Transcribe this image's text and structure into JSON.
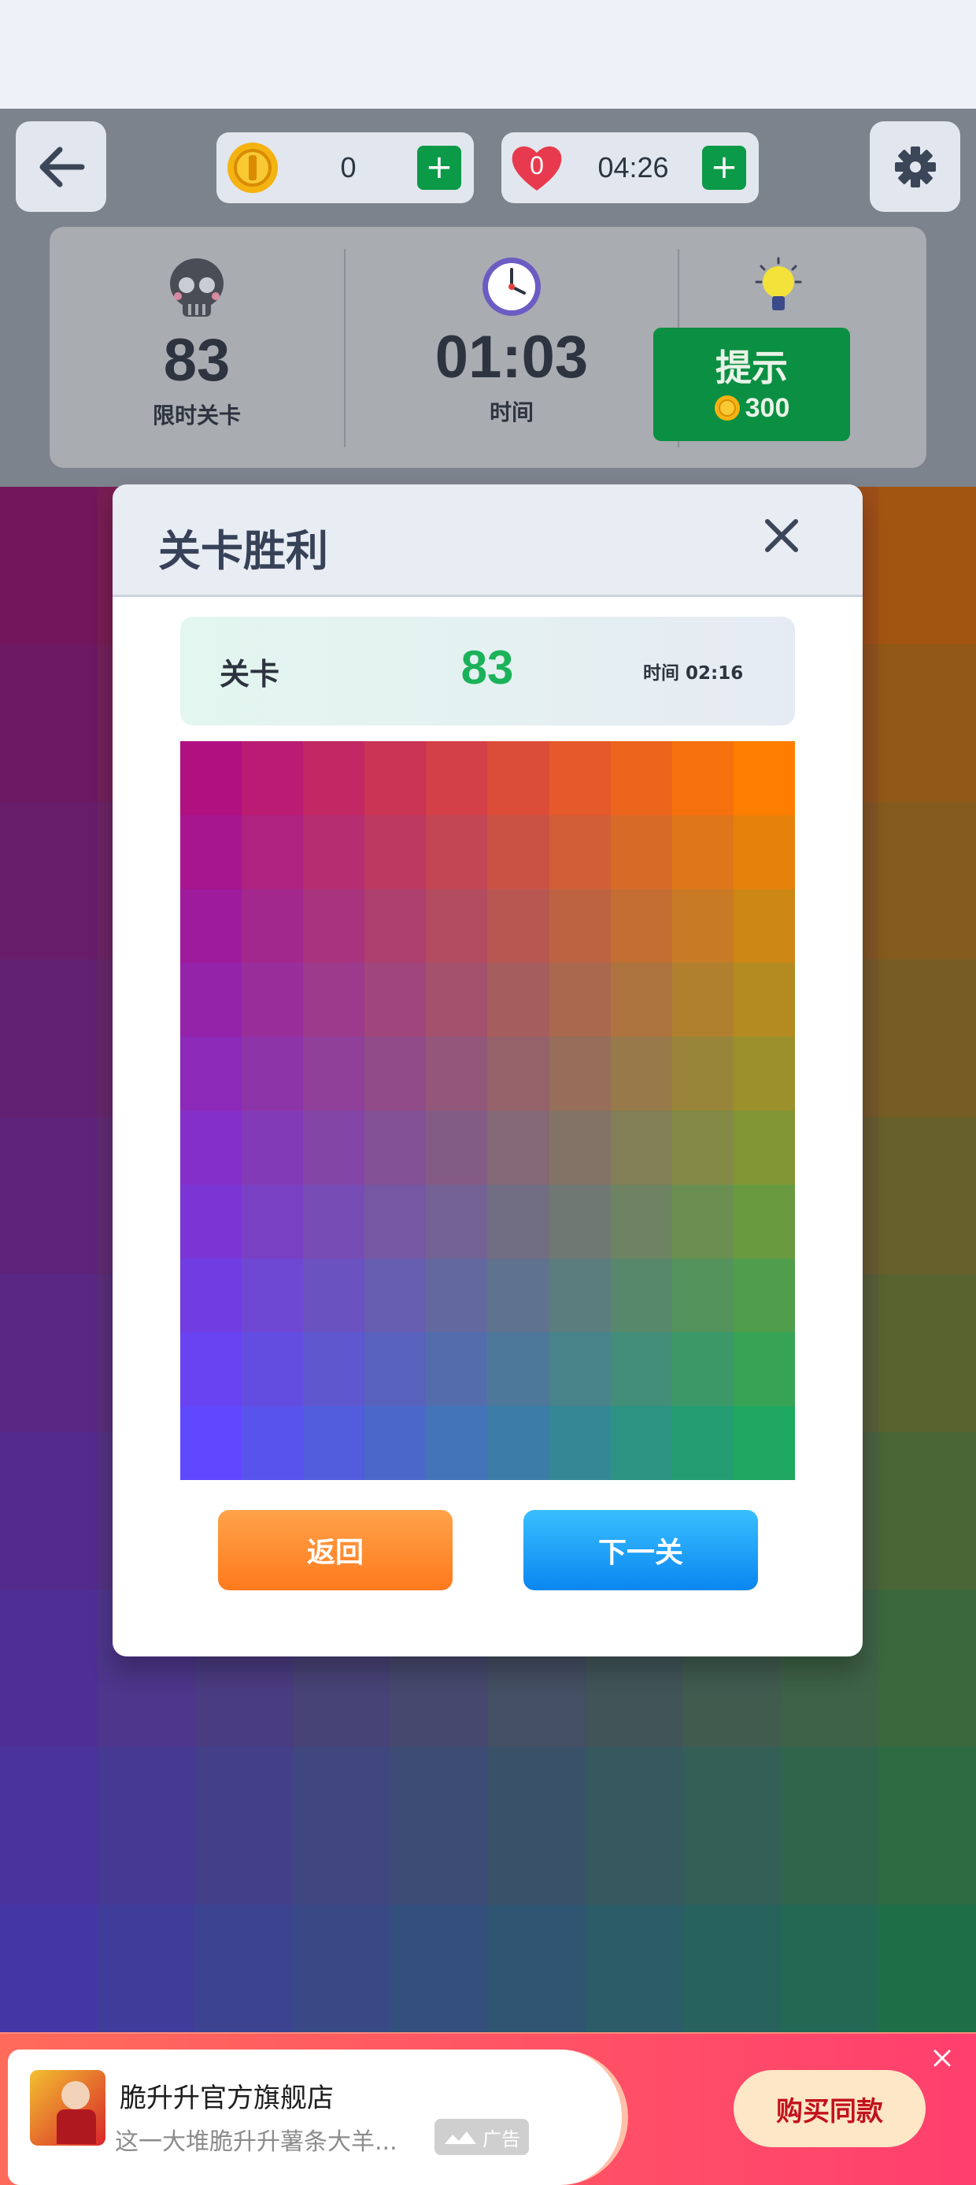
{
  "hud": {
    "coins": "0",
    "lives_timer": "04:26",
    "lives_count": "0",
    "plus": "+"
  },
  "stats": {
    "level_value": "83",
    "level_label": "限时关卡",
    "time_value": "01:03",
    "time_label": "时间",
    "hint_label": "提示",
    "hint_cost": "300"
  },
  "modal": {
    "title": "关卡胜利",
    "level_label": "关卡",
    "level_value": "83",
    "time_text": "时间 02:16",
    "back_button": "返回",
    "next_button": "下一关"
  },
  "ad": {
    "store_name": "脆升升官方旗舰店",
    "description": "这一大堆脆升升薯条大羊...",
    "ad_tag": "广告",
    "buy_button": "购买同款"
  },
  "icons": [
    "back-arrow-icon",
    "coin-icon",
    "heart-icon",
    "gear-icon",
    "skull-icon",
    "clock-icon",
    "lightbulb-icon",
    "close-icon"
  ],
  "colors": {
    "green": "#0a9a48",
    "orange_button": "#ff8a2a",
    "blue_button": "#1aa3f8",
    "level_number_green": "#1bb25a",
    "ad_red": "#ff5560"
  },
  "palette": {
    "top_left": "#b01080",
    "top_right": "#ff7d00",
    "bottom_left": "#6048ff",
    "bottom_right": "#1ea860"
  }
}
